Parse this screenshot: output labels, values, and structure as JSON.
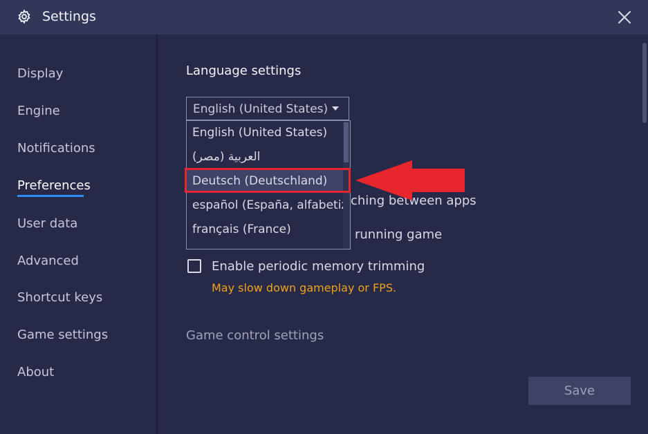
{
  "window": {
    "title": "Settings"
  },
  "sidebar": {
    "items": [
      {
        "label": "Display"
      },
      {
        "label": "Engine"
      },
      {
        "label": "Notifications"
      },
      {
        "label": "Preferences"
      },
      {
        "label": "User data"
      },
      {
        "label": "Advanced"
      },
      {
        "label": "Shortcut keys"
      },
      {
        "label": "Game settings"
      },
      {
        "label": "About"
      }
    ],
    "active": "Preferences"
  },
  "main": {
    "language_section_title": "Language settings",
    "language_dropdown": {
      "selected": "English (United States)",
      "options": [
        {
          "label": "English (United States)"
        },
        {
          "label": "العربية (مصر)"
        },
        {
          "label": "Deutsch (Deutschland)"
        },
        {
          "label": "español (España, alfabetiza"
        },
        {
          "label": "français (France)"
        }
      ],
      "highlighted": "Deutsch (Deutschland)"
    },
    "obscured_option_1_fragment": "ching between apps",
    "obscured_option_2_fragment": "running game",
    "memory_trim": {
      "label": "Enable periodic memory trimming",
      "checked": false,
      "warning": "May slow down gameplay or FPS."
    },
    "game_control_section_title": "Game control settings",
    "save_label": "Save"
  },
  "colors": {
    "accent": "#2c8df4",
    "annotation": "#e8262e",
    "warning": "#f0a21b"
  },
  "icons": {
    "title": "gear-icon",
    "close": "close-icon",
    "dropdown": "caret-down-icon",
    "annotation": "arrow-left-icon"
  }
}
